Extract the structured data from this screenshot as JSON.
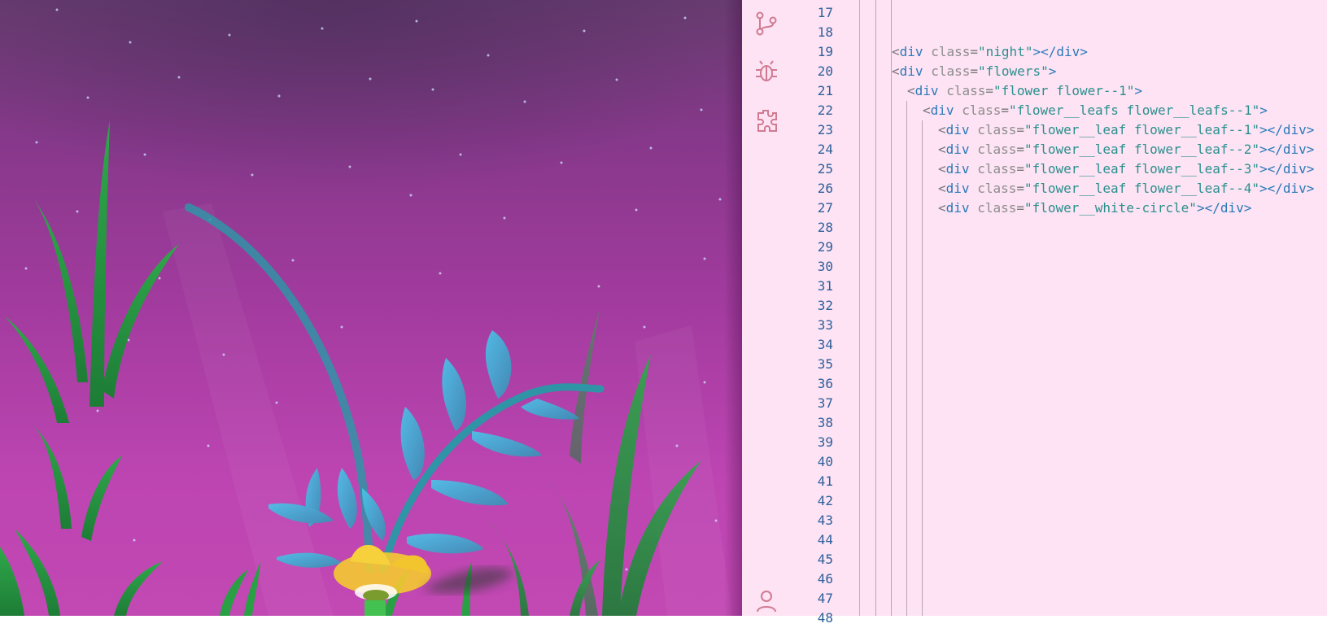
{
  "activity_bar": {
    "icons": [
      "source-control-icon",
      "debug-icon",
      "extensions-icon",
      "account-icon"
    ]
  },
  "editor": {
    "line_numbers": [
      "17",
      "18",
      "19",
      "20",
      "21",
      "22",
      "23",
      "24",
      "25",
      "26",
      "27",
      "28",
      "29",
      "30",
      "31",
      "32",
      "33",
      "34",
      "35",
      "36",
      "37",
      "38",
      "39",
      "40",
      "41",
      "42",
      "43",
      "44",
      "45",
      "46",
      "47",
      "48"
    ],
    "code_lines": [
      {
        "line": "19",
        "tag": "div",
        "attr": "class",
        "value": "night",
        "closing": "></div>"
      },
      {
        "line": "20",
        "tag": "div",
        "attr": "class",
        "value": "flowers",
        "closing": ">"
      },
      {
        "line": "21",
        "tag": "div",
        "attr": "class",
        "value": "flower flower--1",
        "closing": ">"
      },
      {
        "line": "22",
        "tag": "div",
        "attr": "class",
        "value": "flower__leafs flower__leafs--1",
        "closing": ">"
      },
      {
        "line": "23",
        "tag": "div",
        "attr": "class",
        "value": "flower__leaf flower__leaf--1",
        "closing": "></div>"
      },
      {
        "line": "24",
        "tag": "div",
        "attr": "class",
        "value": "flower__leaf flower__leaf--2",
        "closing": "></div>"
      },
      {
        "line": "25",
        "tag": "div",
        "attr": "class",
        "value": "flower__leaf flower__leaf--3",
        "closing": "></div>"
      },
      {
        "line": "26",
        "tag": "div",
        "attr": "class",
        "value": "flower__leaf flower__leaf--4",
        "closing": "></div>"
      },
      {
        "line": "27",
        "tag": "div",
        "attr": "class",
        "value": "flower__white-circle",
        "closing": "></div>"
      }
    ]
  },
  "colors": {
    "editor_bg": "#fde3f4",
    "line_number": "#2e5f9a",
    "tag": "#2a79b8",
    "string": "#2b8f8d",
    "attribute": "#8d8d8d",
    "scene_top": "#6a3d72",
    "scene_bottom": "#c248b3"
  }
}
